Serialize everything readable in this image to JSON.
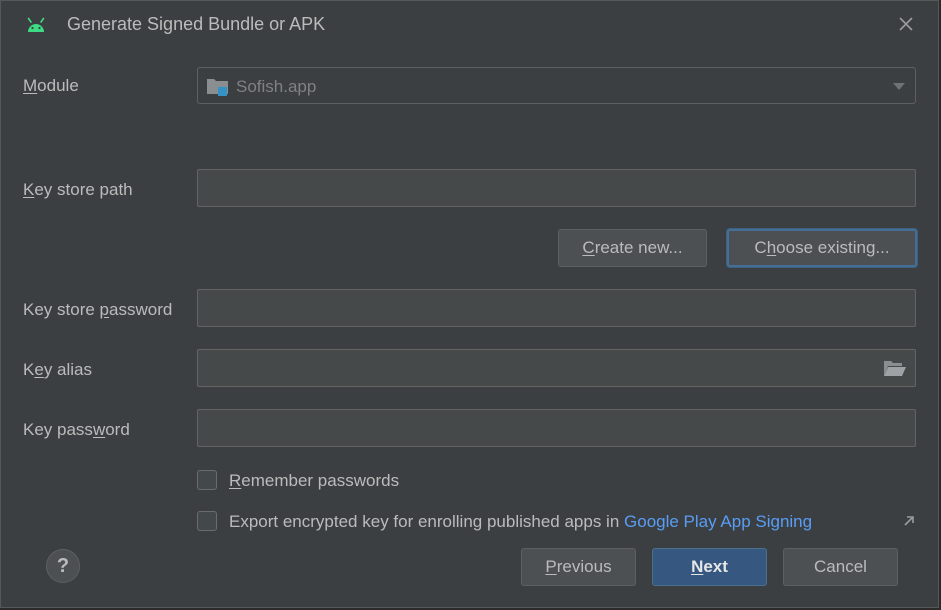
{
  "window": {
    "title": "Generate Signed Bundle or APK",
    "title_icon": "android-icon",
    "close_icon": "close-icon"
  },
  "module": {
    "label_mnemonic": "M",
    "label_rest": "odule",
    "selected": "Sofish.app",
    "icon": "module-folder-icon"
  },
  "key_store_path": {
    "label_mnemonic": "K",
    "label_rest": "ey store path",
    "value": ""
  },
  "buttons": {
    "create_new_mnemonic": "C",
    "create_new_rest": "reate new...",
    "choose_existing_pre": "C",
    "choose_existing_mnemonic": "h",
    "choose_existing_rest": "oose existing...",
    "previous_mnemonic": "P",
    "previous_rest": "revious",
    "next_mnemonic": "N",
    "next_rest": "ext",
    "cancel": "Cancel",
    "help": "?"
  },
  "key_store_password": {
    "label_pre": "Key store ",
    "label_mnemonic": "p",
    "label_rest": "assword",
    "value": ""
  },
  "key_alias": {
    "label_pre": "K",
    "label_mnemonic": "e",
    "label_rest": "y alias",
    "value": "",
    "browse_icon": "folder-open-icon"
  },
  "key_password": {
    "label_pre": "Key pass",
    "label_mnemonic": "w",
    "label_rest": "ord",
    "value": ""
  },
  "options": {
    "remember_mnemonic": "R",
    "remember_rest": "emember passwords",
    "remember_checked": false,
    "export_text": "Export encrypted key for enrolling published apps in ",
    "export_link": "Google Play App Signing",
    "export_checked": false,
    "export_link_icon": "external-link-arrow-icon"
  },
  "colors": {
    "background": "#3c3f41",
    "field_background": "#45494a",
    "primary_button": "#365880",
    "link": "#589df6",
    "android_green": "#3ddc84"
  }
}
